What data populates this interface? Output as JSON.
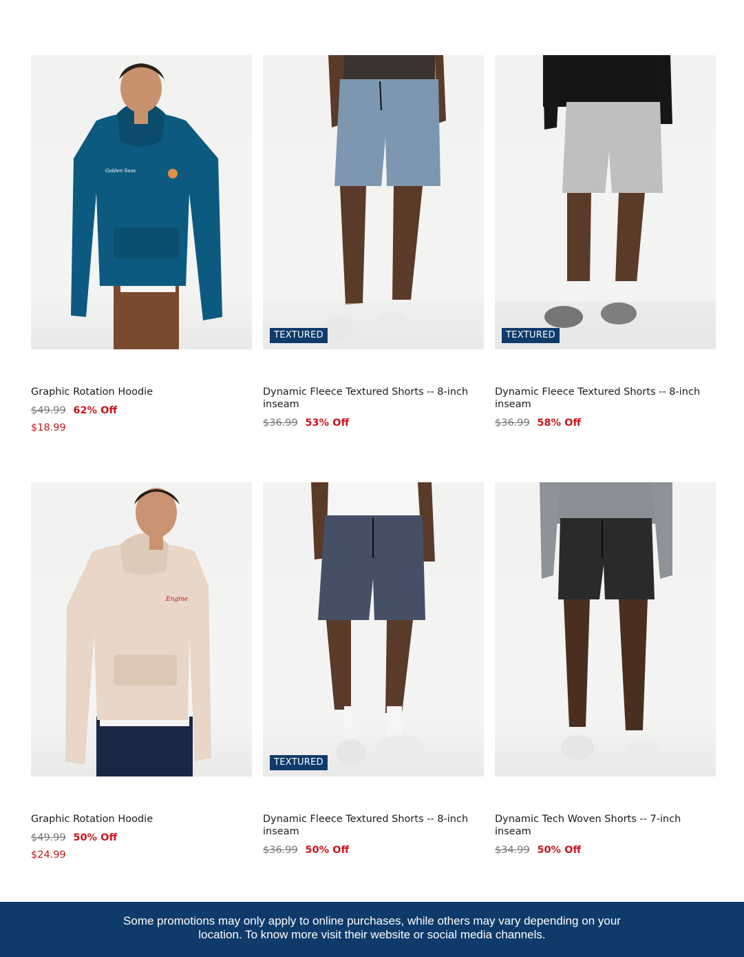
{
  "colors": {
    "brand_navy": "#0f3b6b",
    "sale_red": "#c9161d",
    "strike_gray": "#777777"
  },
  "products": [
    {
      "title": "Graphic Rotation Hoodie",
      "original_price": "$49.99",
      "discount": "62% Off",
      "sale_price": "$18.99",
      "badge": "",
      "image": "blue-hoodie-photo"
    },
    {
      "title": "Dynamic Fleece Textured Shorts -- 8-inch inseam",
      "original_price": "$36.99",
      "discount": "53% Off",
      "sale_price": "",
      "badge": "TEXTURED",
      "image": "light-blue-shorts-photo"
    },
    {
      "title": "Dynamic Fleece Textured Shorts -- 8-inch inseam",
      "original_price": "$36.99",
      "discount": "58% Off",
      "sale_price": "",
      "badge": "TEXTURED",
      "image": "heather-gray-shorts-photo"
    },
    {
      "title": "Graphic Rotation Hoodie",
      "original_price": "$49.99",
      "discount": "50% Off",
      "sale_price": "$24.99",
      "badge": "",
      "image": "beige-hoodie-photo"
    },
    {
      "title": "Dynamic Fleece Textured Shorts -- 8-inch inseam",
      "original_price": "$36.99",
      "discount": "50% Off",
      "sale_price": "",
      "badge": "TEXTURED",
      "image": "navy-shorts-photo"
    },
    {
      "title": "Dynamic Tech Woven Shorts -- 7-inch inseam",
      "original_price": "$34.99",
      "discount": "50% Off",
      "sale_price": "",
      "badge": "",
      "image": "black-shorts-photo"
    }
  ],
  "footer": {
    "line1": "Some promotions may only apply to online purchases, while others may vary depending on your",
    "line2": "location. To know more visit their website or social media channels."
  }
}
